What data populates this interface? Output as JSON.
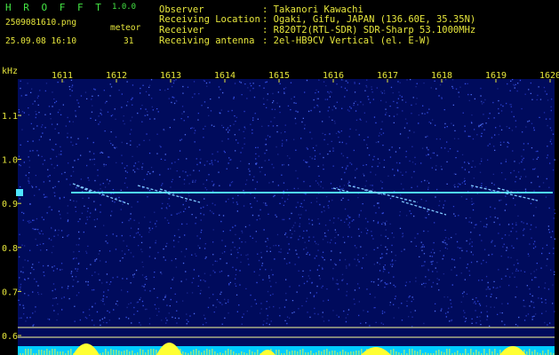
{
  "header": {
    "app_title": "H R O F F T",
    "app_version": "1.0.0",
    "filename": "2509081610.png",
    "timestamp": "25.09.08 16:10",
    "detection_label": "meteor",
    "detection_count": "31"
  },
  "station_info": [
    {
      "label": "Observer",
      "value": ": Takanori Kawachi"
    },
    {
      "label": "Receiving Location",
      "value": ": Ogaki, Gifu, JAPAN (136.60E, 35.35N)"
    },
    {
      "label": "Receiver",
      "value": ": R820T2(RTL-SDR) SDR-Sharp 53.1000MHz"
    },
    {
      "label": "Receiving antenna",
      "value": ": 2el-HB9CV Vertical (el. E-W)"
    }
  ],
  "spectrogram": {
    "freq_unit": "kHz",
    "time_ticks": [
      "1611",
      "1612",
      "1613",
      "1614",
      "1615",
      "1616",
      "1617",
      "1618",
      "1619",
      "1620"
    ],
    "freq_ticks": [
      "1.1",
      "1.0",
      "0.9",
      "0.8",
      "0.7",
      "0.6"
    ],
    "colors": {
      "background": "#000b5c",
      "label": "#e6e63c",
      "carrier": "#4fe6ff",
      "signal_bar": "#ffff33",
      "bottom_bar": "#00ccff",
      "baseline": "#ffff99"
    }
  }
}
